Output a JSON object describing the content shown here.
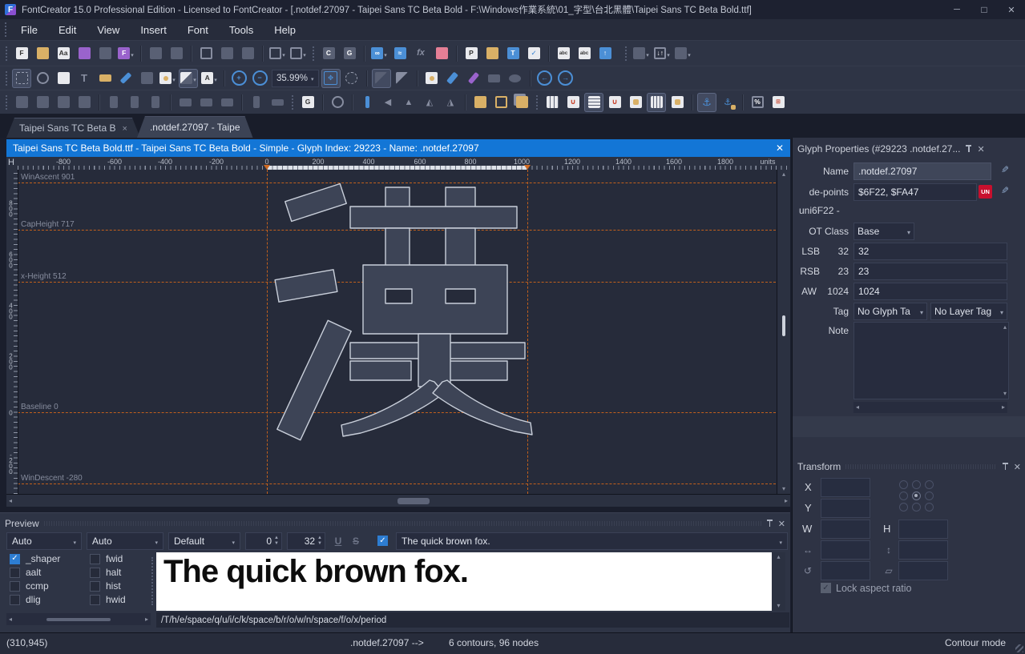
{
  "window": {
    "app_title": "FontCreator 15.0 Professional Edition - Licensed to FontCreator - [.notdef.27097 - Taipei Sans TC Beta Bold - F:\\Windows作業系統\\01_字型\\台北黑體\\Taipei Sans TC Beta Bold.ttf]"
  },
  "menu": {
    "items": [
      "File",
      "Edit",
      "View",
      "Insert",
      "Font",
      "Tools",
      "Help"
    ]
  },
  "toolbar": {
    "zoom_level": "35.99%",
    "icons": {
      "open_installed": "Aa",
      "add_codepoint": "C",
      "add_glyph": "G",
      "function_tool": "fx",
      "properties": "P",
      "naming": "abc",
      "webfont": "abc",
      "glyph_reference": "G",
      "text_tool": "T"
    }
  },
  "tabs": [
    {
      "label": "Taipei Sans TC Beta B"
    },
    {
      "label": ".notdef.27097 - Taipe"
    }
  ],
  "editor": {
    "caption": "Taipei Sans TC Beta Bold.ttf - Taipei Sans TC Beta Bold - Simple - Glyph Index: 29223 - Name: .notdef.27097",
    "glyph_character": "漢",
    "ruler": {
      "corner": "H",
      "units_label": "units",
      "h_ticks": [
        "-800",
        "-600",
        "-400",
        "-200",
        "0",
        "200",
        "400",
        "600",
        "800",
        "1000",
        "1200",
        "1400",
        "1600",
        "1800"
      ],
      "v_ticks": [
        "800",
        "600",
        "400",
        "200",
        "0",
        "-200"
      ]
    },
    "metrics": [
      {
        "label": "WinAscent 901"
      },
      {
        "label": "CapHeight 717"
      },
      {
        "label": "x-Height 512"
      },
      {
        "label": "Baseline 0"
      },
      {
        "label": "WinDescent -280"
      }
    ]
  },
  "glyph_properties": {
    "title": "Glyph Properties (#29223 .notdef.27...",
    "name_label": "Name",
    "name_value": ".notdef.27097",
    "codepoints_label": "de-points",
    "codepoints_value": "$6F22, $FA47",
    "unicode_badge": "UN",
    "unicode_name": "uni6F22 -",
    "ot_class_label": "OT Class",
    "ot_class_value": "Base",
    "lsb_label": "LSB",
    "lsb_current": "32",
    "lsb_value": "32",
    "rsb_label": "RSB",
    "rsb_current": "23",
    "rsb_value": "23",
    "aw_label": "AW",
    "aw_current": "1024",
    "aw_value": "1024",
    "tag_label": "Tag",
    "glyph_tag_value": "No Glyph Ta",
    "layer_tag_value": "No Layer Tag",
    "note_label": "Note"
  },
  "transform": {
    "title": "Transform",
    "x_label": "X",
    "y_label": "Y",
    "w_label": "W",
    "h_label": "H",
    "lock_aspect_label": "Lock aspect ratio"
  },
  "preview": {
    "title": "Preview",
    "shaper_value": "Auto",
    "script_value": "Auto",
    "language_value": "Default",
    "spacing_value": "0",
    "size_value": "32",
    "underline": "U",
    "strikeout": "S",
    "sample_text": "The quick brown fox.",
    "rendered_text": "The quick brown fox.",
    "glyph_run": "/T/h/e/space/q/u/i/c/k/space/b/r/o/w/n/space/f/o/x/period",
    "features_col1": [
      {
        "label": "_shaper",
        "checked": true
      },
      {
        "label": "aalt",
        "checked": false
      },
      {
        "label": "ccmp",
        "checked": false
      },
      {
        "label": "dlig",
        "checked": false
      }
    ],
    "features_col2": [
      {
        "label": "fwid",
        "checked": false
      },
      {
        "label": "halt",
        "checked": false
      },
      {
        "label": "hist",
        "checked": false
      },
      {
        "label": "hwid",
        "checked": false
      }
    ]
  },
  "status_bar": {
    "coordinates": "(310,945)",
    "glyph_name": ".notdef.27097 -->",
    "contours_info": "6 contours, 96 nodes",
    "mode": "Contour mode"
  }
}
